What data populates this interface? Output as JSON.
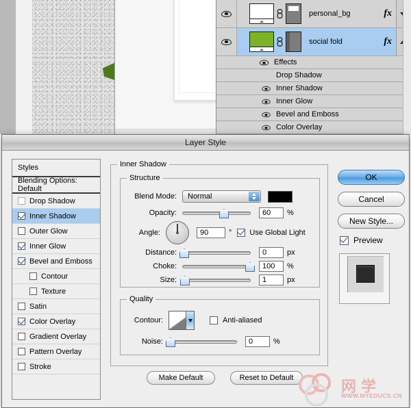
{
  "app": {
    "document_background": "photoshop-canvas"
  },
  "layers_panel": {
    "layers": [
      {
        "name": "personal_bg",
        "visible": true,
        "selected": false,
        "fx_label": "fx",
        "thumb_color": "#ffffff",
        "expand_arrow": "chevron-down"
      },
      {
        "name": "social fold",
        "visible": true,
        "selected": true,
        "fx_label": "fx",
        "thumb_color": "#7cb329",
        "expand_arrow": "chevron-up"
      }
    ],
    "effects_group_label": "Effects",
    "effects": [
      {
        "label": "Drop Shadow",
        "visible": false
      },
      {
        "label": "Inner Shadow",
        "visible": true
      },
      {
        "label": "Inner Glow",
        "visible": true
      },
      {
        "label": "Bevel and Emboss",
        "visible": true
      },
      {
        "label": "Color Overlay",
        "visible": true
      }
    ]
  },
  "dialog": {
    "title": "Layer Style",
    "styles_list": {
      "header": "Styles",
      "blending_options": "Blending Options: Default",
      "items": [
        {
          "label": "Drop Shadow",
          "checked": false,
          "sub": false,
          "active": false,
          "dim": true
        },
        {
          "label": "Inner Shadow",
          "checked": true,
          "sub": false,
          "active": true,
          "dim": false
        },
        {
          "label": "Outer Glow",
          "checked": false,
          "sub": false,
          "active": false,
          "dim": false
        },
        {
          "label": "Inner Glow",
          "checked": true,
          "sub": false,
          "active": false,
          "dim": false
        },
        {
          "label": "Bevel and Emboss",
          "checked": true,
          "sub": false,
          "active": false,
          "dim": false
        },
        {
          "label": "Contour",
          "checked": false,
          "sub": true,
          "active": false,
          "dim": false
        },
        {
          "label": "Texture",
          "checked": false,
          "sub": true,
          "active": false,
          "dim": false
        },
        {
          "label": "Satin",
          "checked": false,
          "sub": false,
          "active": false,
          "dim": false
        },
        {
          "label": "Color Overlay",
          "checked": true,
          "sub": false,
          "active": false,
          "dim": false
        },
        {
          "label": "Gradient Overlay",
          "checked": false,
          "sub": false,
          "active": false,
          "dim": false
        },
        {
          "label": "Pattern Overlay",
          "checked": false,
          "sub": false,
          "active": false,
          "dim": false
        },
        {
          "label": "Stroke",
          "checked": false,
          "sub": false,
          "active": false,
          "dim": false
        }
      ]
    },
    "panel": {
      "title": "Inner Shadow",
      "structure": {
        "legend": "Structure",
        "blend_mode_label": "Blend Mode:",
        "blend_mode_value": "Normal",
        "shadow_color": "#000000",
        "opacity_label": "Opacity:",
        "opacity_value": "60",
        "opacity_unit": "%",
        "opacity_percent": 60,
        "angle_label": "Angle:",
        "angle_value": "90",
        "angle_unit": "°",
        "use_global_light_label": "Use Global Light",
        "use_global_light_checked": true,
        "distance_label": "Distance:",
        "distance_value": "0",
        "distance_unit": "px",
        "distance_percent": 0,
        "choke_label": "Choke:",
        "choke_value": "100",
        "choke_unit": "%",
        "choke_percent": 100,
        "size_label": "Size:",
        "size_value": "1",
        "size_unit": "px",
        "size_percent": 1
      },
      "quality": {
        "legend": "Quality",
        "contour_label": "Contour:",
        "anti_aliased_label": "Anti-aliased",
        "anti_aliased_checked": false,
        "noise_label": "Noise:",
        "noise_value": "0",
        "noise_unit": "%",
        "noise_percent": 0
      },
      "make_default_label": "Make Default",
      "reset_to_default_label": "Reset to Default"
    },
    "buttons": {
      "ok": "OK",
      "cancel": "Cancel",
      "new_style": "New Style...",
      "preview_label": "Preview",
      "preview_checked": true
    }
  },
  "watermark": {
    "text_cn": "网学",
    "url": "WWW.MYEDUCS.CN"
  }
}
